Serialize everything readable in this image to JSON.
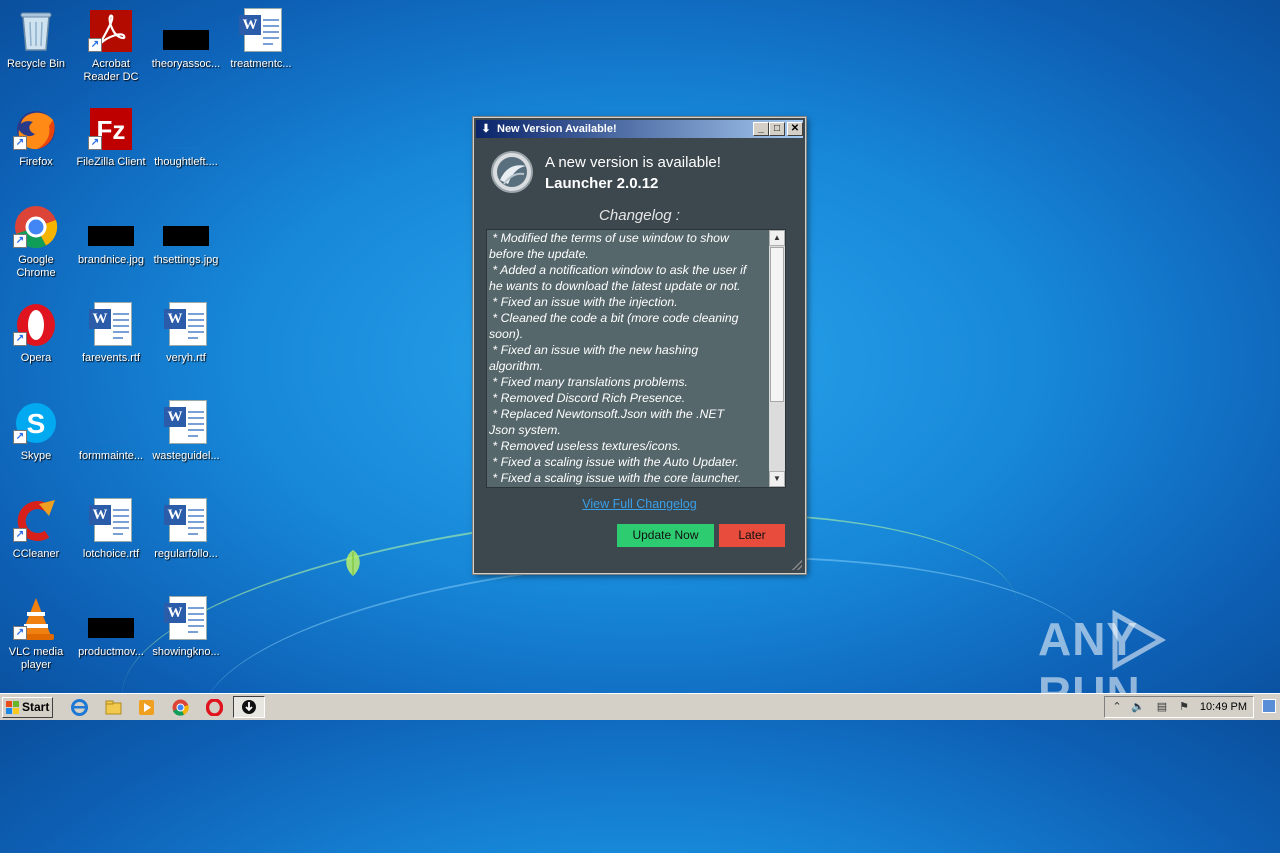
{
  "desktop": {
    "icons": [
      {
        "label": "Recycle Bin",
        "icon": "recycle-bin-icon"
      },
      {
        "label": "Acrobat Reader DC",
        "icon": "acrobat-icon"
      },
      {
        "label": "theoryassoc...",
        "icon": "redacted-file-icon"
      },
      {
        "label": "treatmentc...",
        "icon": "word-doc-icon"
      },
      {
        "label": "Firefox",
        "icon": "firefox-icon"
      },
      {
        "label": "FileZilla Client",
        "icon": "filezilla-icon"
      },
      {
        "label": "thoughtleft....",
        "icon": "file-icon"
      },
      {
        "label": "Google Chrome",
        "icon": "chrome-icon"
      },
      {
        "label": "brandnice.jpg",
        "icon": "redacted-image-icon"
      },
      {
        "label": "thsettings.jpg",
        "icon": "redacted-image-icon"
      },
      {
        "label": "Opera",
        "icon": "opera-icon"
      },
      {
        "label": "farevents.rtf",
        "icon": "word-doc-icon"
      },
      {
        "label": "veryh.rtf",
        "icon": "word-doc-icon"
      },
      {
        "label": "Skype",
        "icon": "skype-icon"
      },
      {
        "label": "formmainte...",
        "icon": "file-icon"
      },
      {
        "label": "wasteguidel...",
        "icon": "word-doc-icon"
      },
      {
        "label": "CCleaner",
        "icon": "ccleaner-icon"
      },
      {
        "label": "lotchoice.rtf",
        "icon": "word-doc-icon"
      },
      {
        "label": "regularfollo...",
        "icon": "word-doc-icon"
      },
      {
        "label": "VLC media player",
        "icon": "vlc-icon"
      },
      {
        "label": "productmov...",
        "icon": "redacted-file-icon"
      },
      {
        "label": "showingkno...",
        "icon": "word-doc-icon"
      }
    ]
  },
  "dialog": {
    "title": "New Version Available!",
    "headline": "A new version is available!",
    "version": "Launcher 2.0.12",
    "changelog_title": "Changelog :",
    "changelog_lines": [
      " * Modified the terms of use window to show",
      "before the update.",
      " * Added a notification window to ask the user if",
      "he wants to download the latest update or not.",
      " * Fixed an issue with the injection.",
      " * Cleaned the code a bit (more code cleaning",
      "soon).",
      " * Fixed an issue with the new hashing",
      "algorithm.",
      " * Fixed many translations problems.",
      " * Removed Discord Rich Presence.",
      " * Replaced Newtonsoft.Json with the .NET",
      "Json system.",
      " * Removed useless textures/icons.",
      " * Fixed a scaling issue with the Auto Updater.",
      " * Fixed a scaling issue with the core launcher."
    ],
    "view_full_link": "View Full Changelog",
    "update_button": "Update Now",
    "later_button": "Later",
    "colors": {
      "background": "#3c474e",
      "update": "#2ecc71",
      "later": "#e74c3c",
      "link": "#3aa0e8"
    }
  },
  "taskbar": {
    "start_label": "Start",
    "clock": "10:49 PM",
    "quicklaunch": [
      "ie-icon",
      "explorer-icon",
      "media-player-icon",
      "chrome-icon",
      "opera-icon",
      "launcher-app-icon"
    ]
  },
  "watermark": {
    "left": "ANY",
    "right": "RUN"
  }
}
